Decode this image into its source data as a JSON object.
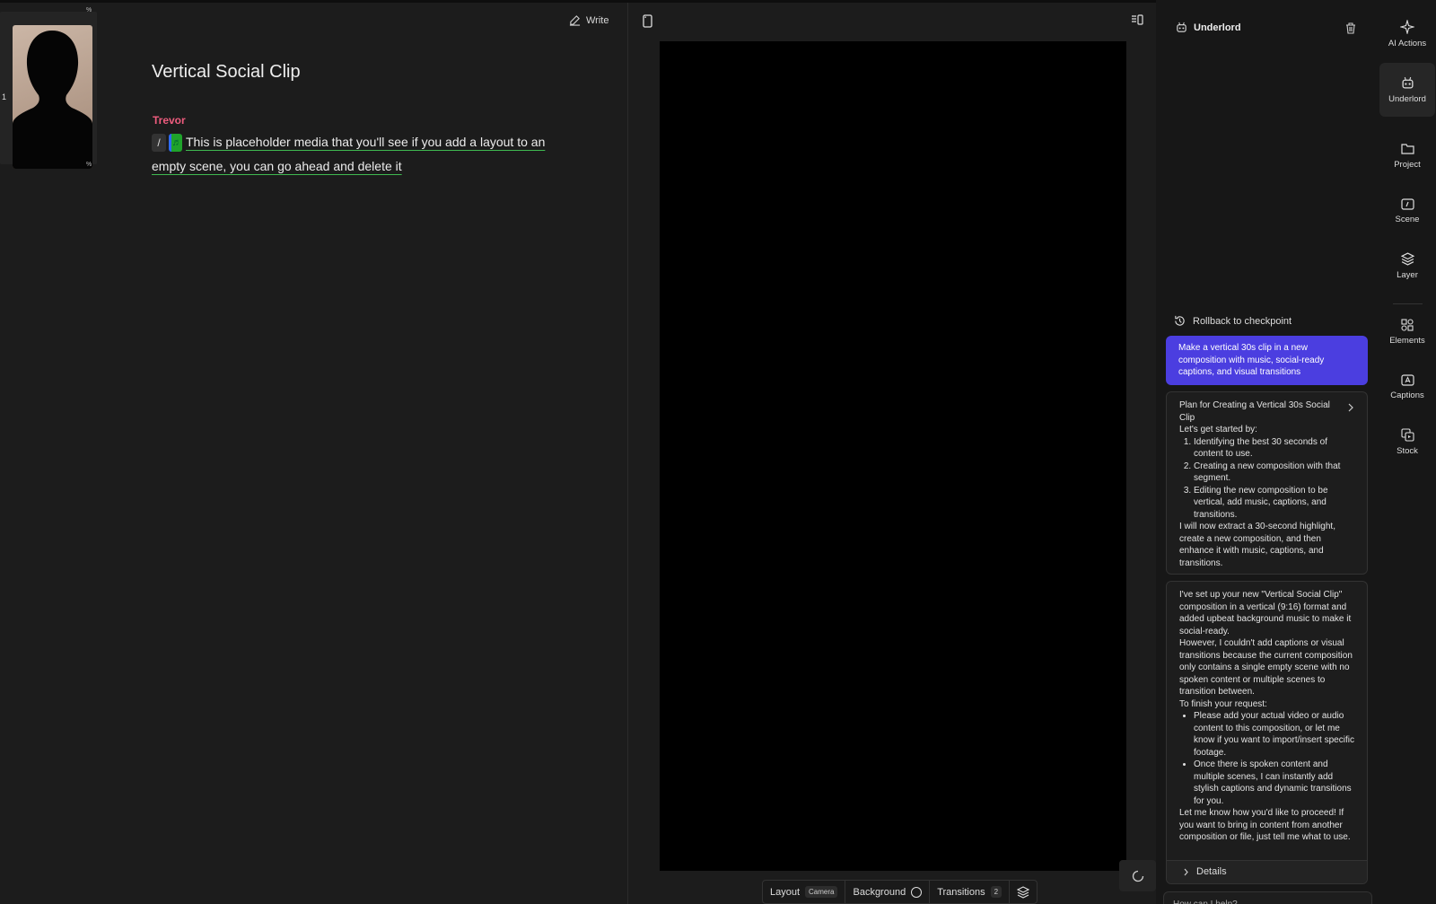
{
  "script": {
    "write_label": "Write",
    "title": "Vertical Social Clip",
    "speaker": "Trevor",
    "slash": "/",
    "music_glyph": "♬",
    "text_line1": "This is placeholder media that you'll see if you add a layout to an",
    "text_line2": "empty scene, you can go ahead and delete it",
    "scene_number": "1",
    "scene_marker": "%"
  },
  "preview": {
    "bottom_bar": {
      "layout_label": "Layout",
      "layout_value": "Camera",
      "background_label": "Background",
      "transitions_label": "Transitions",
      "transitions_count": "2"
    }
  },
  "underlord": {
    "title": "Underlord",
    "rollback_label": "Rollback to checkpoint",
    "user_message": "Make a vertical 30s clip in a new composition with music, social-ready captions, and visual transitions",
    "plan": {
      "title": "Plan for Creating a Vertical 30s Social Clip",
      "intro": "Let's get started by:",
      "steps": [
        "Identifying the best 30 seconds of content to use.",
        "Creating a new composition with that segment.",
        "Editing the new composition to be vertical, add music, captions, and transitions."
      ],
      "outro": "I will now extract a 30-second highlight, create a new composition, and then enhance it with music, captions, and transitions."
    },
    "reply": {
      "p1": "I've set up your new \"Vertical Social Clip\" composition in a vertical (9:16) format and added upbeat background music to make it social-ready.",
      "p2": "However, I couldn't add captions or visual transitions because the current composition only contains a single empty scene with no spoken content or multiple scenes to transition between.",
      "p3": "To finish your request:",
      "bullets": [
        "Please add your actual video or audio content to this composition, or let me know if you want to import/insert specific footage.",
        "Once there is spoken content and multiple scenes, I can instantly add stylish captions and dynamic transitions for you."
      ],
      "p4": "Let me know how you'd like to proceed! If you want to bring in content from another composition or file, just tell me what to use.",
      "details_label": "Details"
    },
    "input_placeholder": "How can I help?"
  },
  "rail": {
    "items": [
      {
        "label": "AI Actions",
        "icon": "sparkle-icon"
      },
      {
        "label": "Underlord",
        "icon": "robot-icon"
      },
      {
        "label": "Project",
        "icon": "folder-icon"
      },
      {
        "label": "Scene",
        "icon": "scene-icon"
      },
      {
        "label": "Layer",
        "icon": "layers-icon"
      },
      {
        "label": "Elements",
        "icon": "elements-icon"
      },
      {
        "label": "Captions",
        "icon": "captions-icon"
      },
      {
        "label": "Stock",
        "icon": "stock-icon"
      }
    ]
  },
  "colors": {
    "accent": "#4b3ee0",
    "speaker": "#ee5c7e",
    "music_chip": "#1fa32b"
  }
}
